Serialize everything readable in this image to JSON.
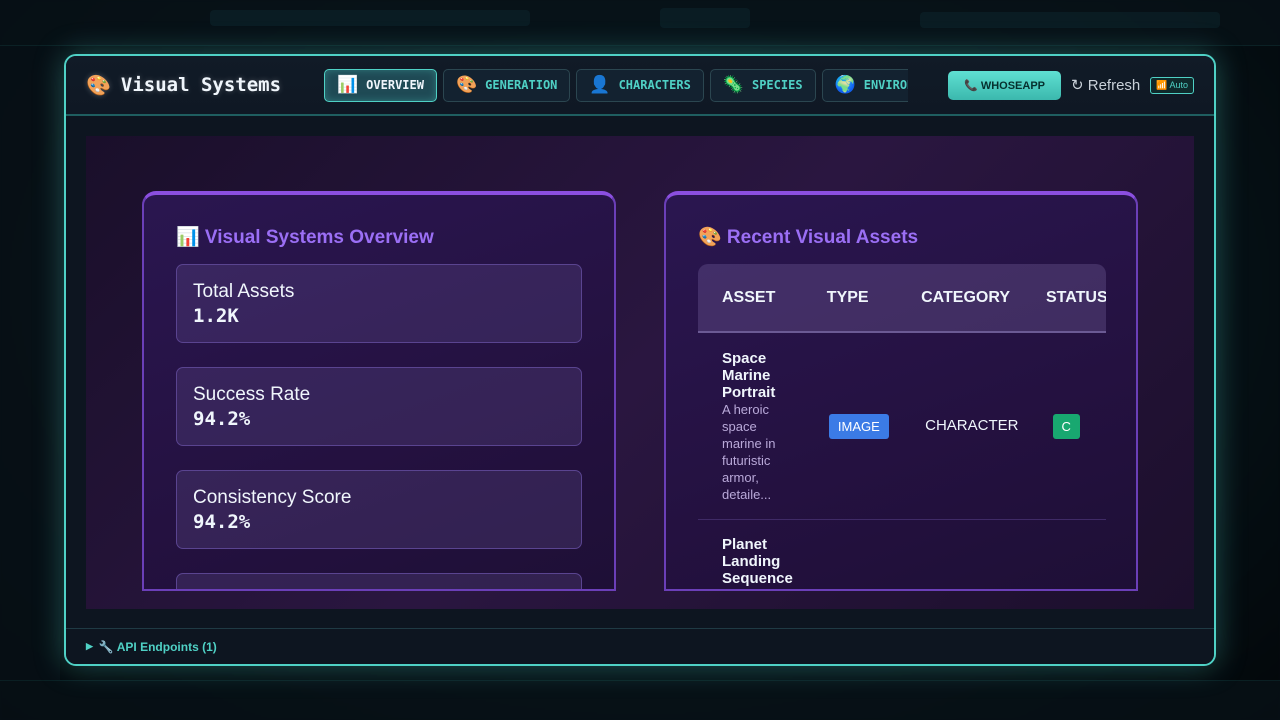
{
  "header": {
    "icon": "palette-icon",
    "title": "Visual Systems",
    "tabs": [
      {
        "icon": "📊",
        "label": "OVERVIEW"
      },
      {
        "icon": "🎨",
        "label": "GENERATION"
      },
      {
        "icon": "👤",
        "label": "CHARACTERS"
      },
      {
        "icon": "🦠",
        "label": "SPECIES"
      },
      {
        "icon": "🌍",
        "label": "ENVIRONMENTS"
      }
    ],
    "whoseapp_label": "📞 WHOSEAPP",
    "refresh_label": "↻ Refresh",
    "auto_label": "📶 Auto"
  },
  "overview": {
    "title": "📊 Visual Systems Overview",
    "stats": [
      {
        "label": "Total Assets",
        "value": "1.2K"
      },
      {
        "label": "Success Rate",
        "value": "94.2%"
      },
      {
        "label": "Consistency Score",
        "value": "94.2%"
      }
    ]
  },
  "recent": {
    "title": "🎨 Recent Visual Assets",
    "columns": [
      "ASSET",
      "TYPE",
      "CATEGORY",
      "STATUS"
    ],
    "rows": [
      {
        "name": "Space Marine Portrait",
        "desc": "A heroic space marine in futuristic armor, detaile...",
        "type": "IMAGE",
        "category": "CHARACTER",
        "status": "C"
      },
      {
        "name": "Planet Landing Sequence",
        "desc": "",
        "type": "",
        "category": "",
        "status": ""
      }
    ]
  },
  "footer": {
    "label": "🔧 API Endpoints (1)"
  },
  "colors": {
    "accent": "#4fd1c5",
    "purple": "#9b6ff5",
    "type_pill": "#3b7be6",
    "status_pill": "#18a870"
  }
}
